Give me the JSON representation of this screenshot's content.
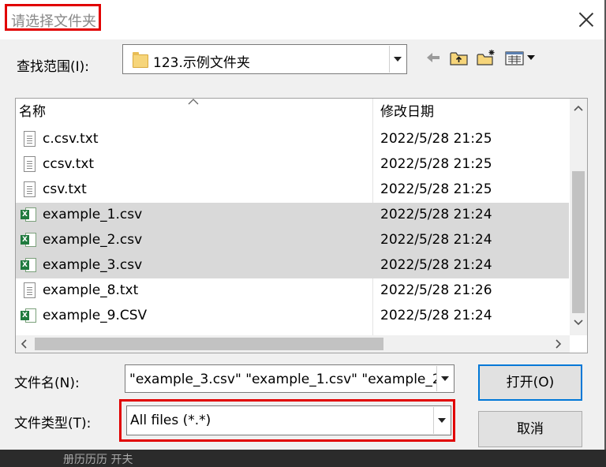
{
  "dialog": {
    "title": "请选择文件夹"
  },
  "lookin": {
    "label": "查找范围(I):",
    "value": "123.示例文件夹"
  },
  "toolbar": {
    "icons": [
      "back-arrow-icon",
      "up-folder-icon",
      "new-folder-icon",
      "view-menu-icon"
    ]
  },
  "list": {
    "columns": {
      "name": "名称",
      "date": "修改日期"
    },
    "rows": [
      {
        "name": "c.csv.txt",
        "date": "2022/5/28 21:25",
        "icon": "text-file-icon",
        "selected": false
      },
      {
        "name": "ccsv.txt",
        "date": "2022/5/28 21:25",
        "icon": "text-file-icon",
        "selected": false
      },
      {
        "name": "csv.txt",
        "date": "2022/5/28 21:25",
        "icon": "text-file-icon",
        "selected": false
      },
      {
        "name": "example_1.csv",
        "date": "2022/5/28 21:24",
        "icon": "excel-file-icon",
        "selected": true
      },
      {
        "name": "example_2.csv",
        "date": "2022/5/28 21:24",
        "icon": "excel-file-icon",
        "selected": true
      },
      {
        "name": "example_3.csv",
        "date": "2022/5/28 21:24",
        "icon": "excel-file-icon",
        "selected": true
      },
      {
        "name": "example_8.txt",
        "date": "2022/5/28 21:26",
        "icon": "text-file-icon",
        "selected": false
      },
      {
        "name": "example_9.CSV",
        "date": "2022/5/28 21:24",
        "icon": "excel-file-icon",
        "selected": false
      }
    ]
  },
  "filename": {
    "label": "文件名(N):",
    "value": "\"example_3.csv\" \"example_1.csv\" \"example_2"
  },
  "filetype": {
    "label": "文件类型(T):",
    "value": "All files (*.*)"
  },
  "buttons": {
    "open": "打开(O)",
    "cancel": "取消"
  },
  "background": {
    "text": "册历历历 开夫"
  },
  "colors": {
    "highlight_red": "#e10000",
    "selection_gray": "#d9d9d9",
    "dialog_bg": "#f0f0f0"
  }
}
